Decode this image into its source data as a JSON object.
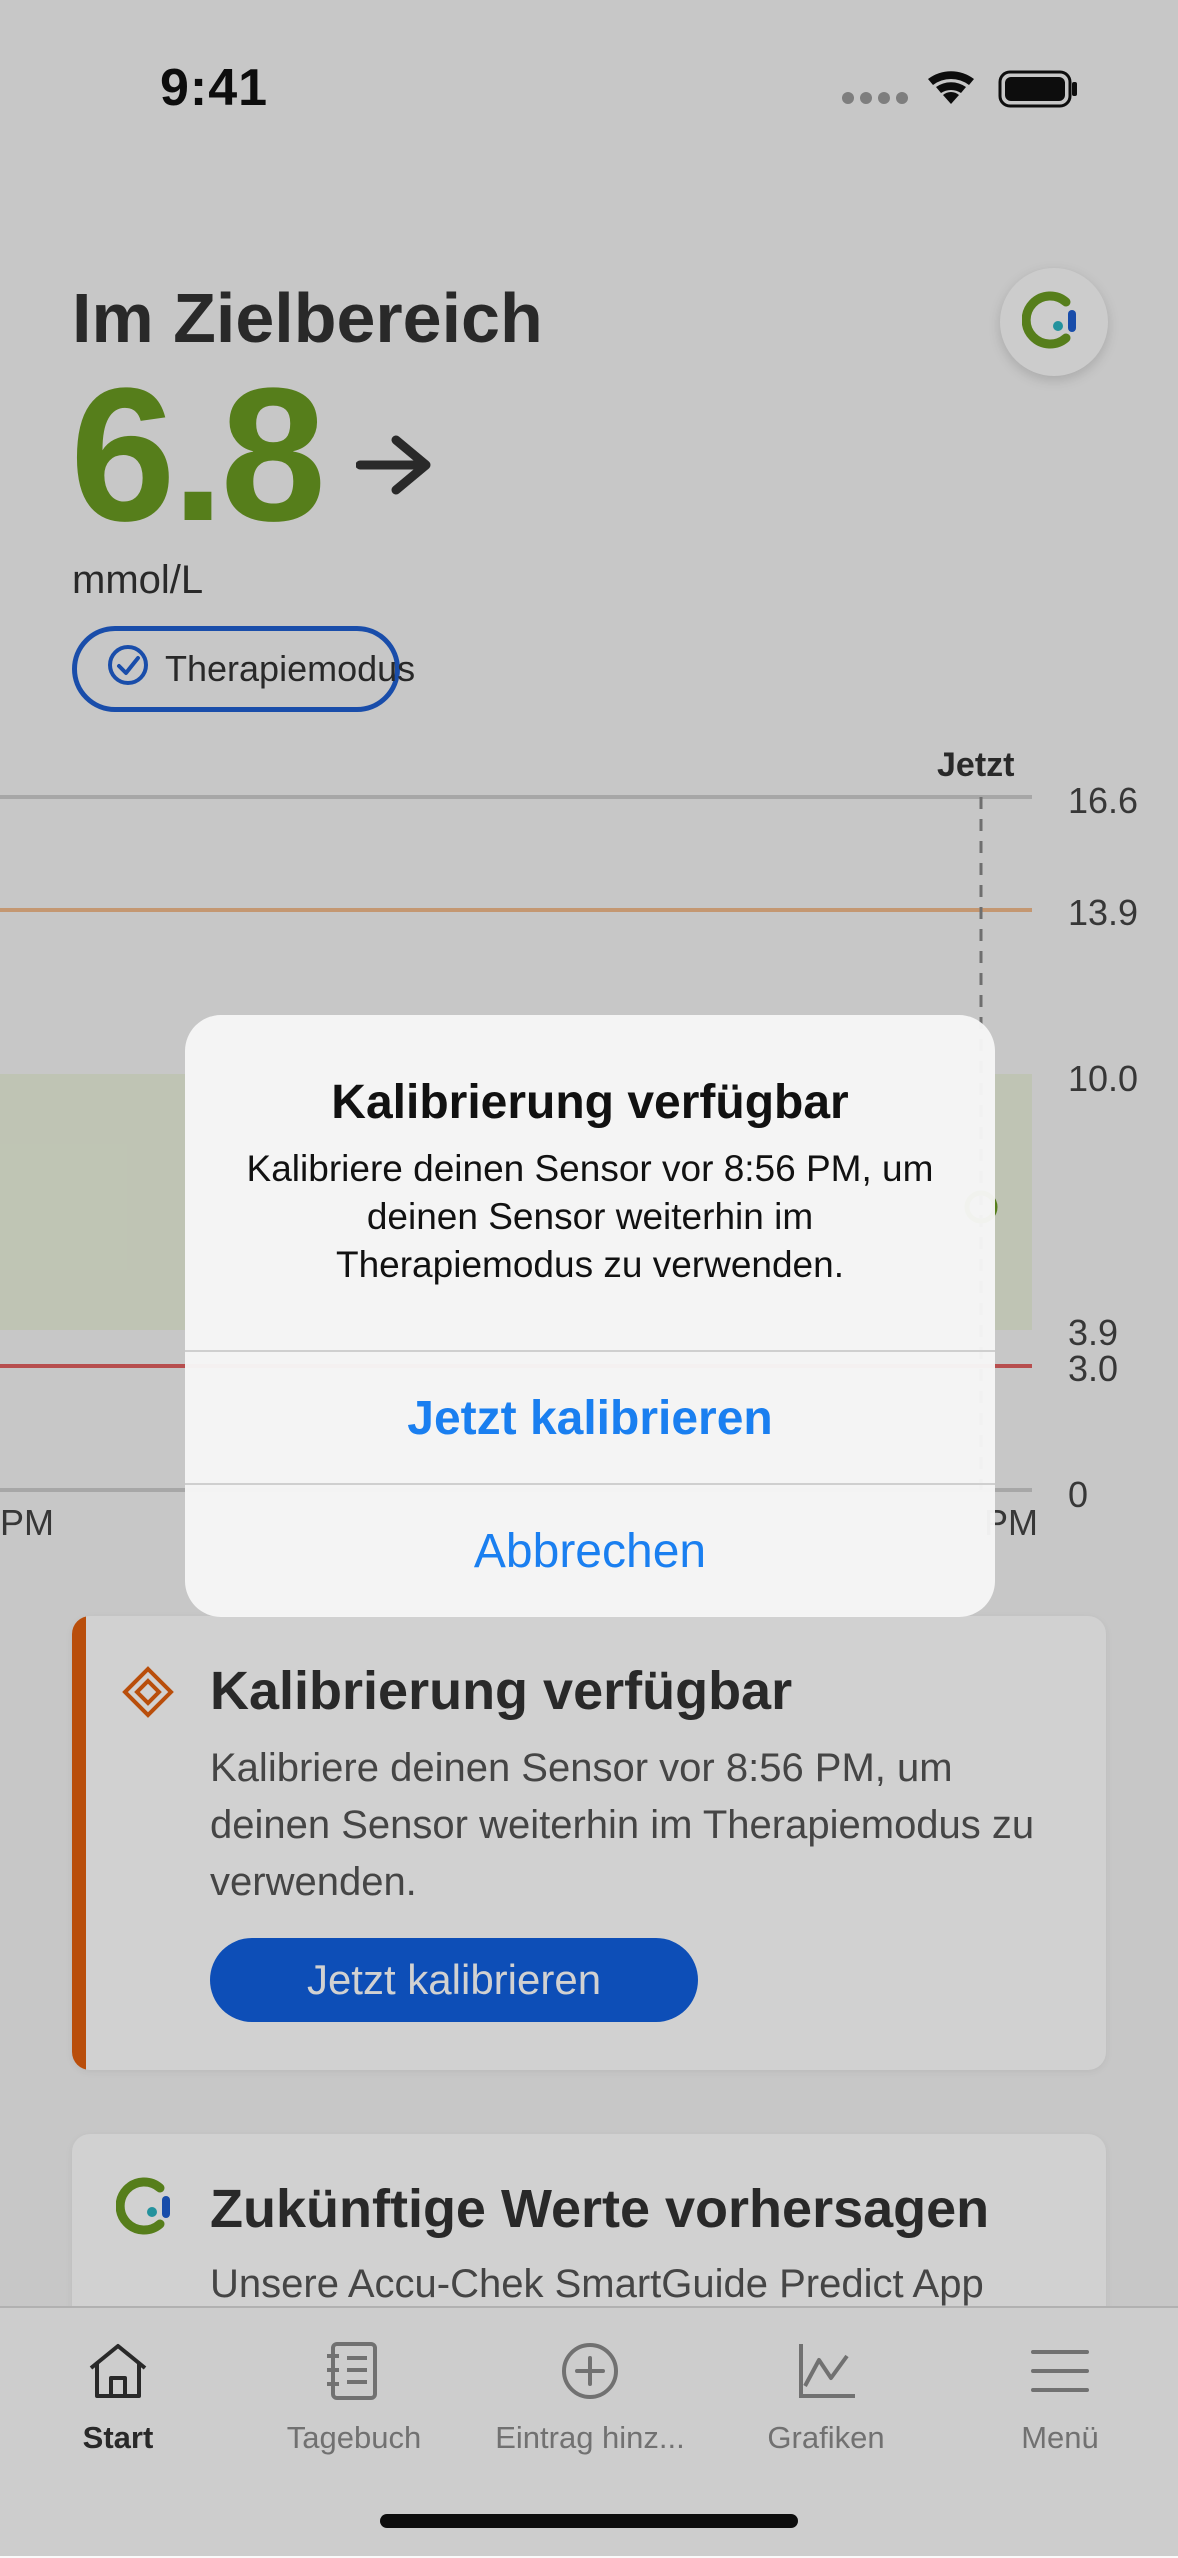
{
  "status_bar": {
    "time": "9:41"
  },
  "header": {
    "title": "Im Zielbereich",
    "glucose_value": "6.8",
    "trend_icon": "arrow-right-icon",
    "unit": "mmol/L",
    "mode_badge": "Therapiemodus"
  },
  "chart": {
    "now_label": "Jetzt",
    "y_ticks": [
      "16.6",
      "13.9",
      "10.0",
      "3.9",
      "3.0",
      "0"
    ],
    "x_left_label": "PM",
    "x_right_label": "PM",
    "colors": {
      "high_line": "#f0b98a",
      "low_line": "#e06060",
      "target_band": "#e9f0dc",
      "grid": "#cccccc",
      "point": "#6a9a22"
    }
  },
  "card_calibration": {
    "title": "Kalibrierung verfügbar",
    "text": "Kalibriere deinen Sensor vor 8:56 PM, um deinen Sensor weiterhin im Therapiemodus zu verwenden.",
    "button": "Jetzt kalibrieren",
    "accent": "#e2600e"
  },
  "card_predict": {
    "title": "Zukünftige Werte vorhersagen",
    "text": "Unsere Accu-Chek SmartGuide Predict App"
  },
  "tabbar": {
    "items": [
      {
        "label": "Start",
        "icon": "home-icon",
        "active": true
      },
      {
        "label": "Tagebuch",
        "icon": "diary-icon",
        "active": false
      },
      {
        "label": "Eintrag hinz...",
        "icon": "add-circle-icon",
        "active": false
      },
      {
        "label": "Grafiken",
        "icon": "chart-icon",
        "active": false
      },
      {
        "label": "Menü",
        "icon": "menu-icon",
        "active": false
      }
    ]
  },
  "alert": {
    "title": "Kalibrierung verfügbar",
    "message": "Kalibriere deinen Sensor vor 8:56 PM, um deinen Sensor weiterhin im Therapiemodus zu verwenden.",
    "primary_button": "Jetzt kalibrieren",
    "cancel_button": "Abbrechen"
  }
}
